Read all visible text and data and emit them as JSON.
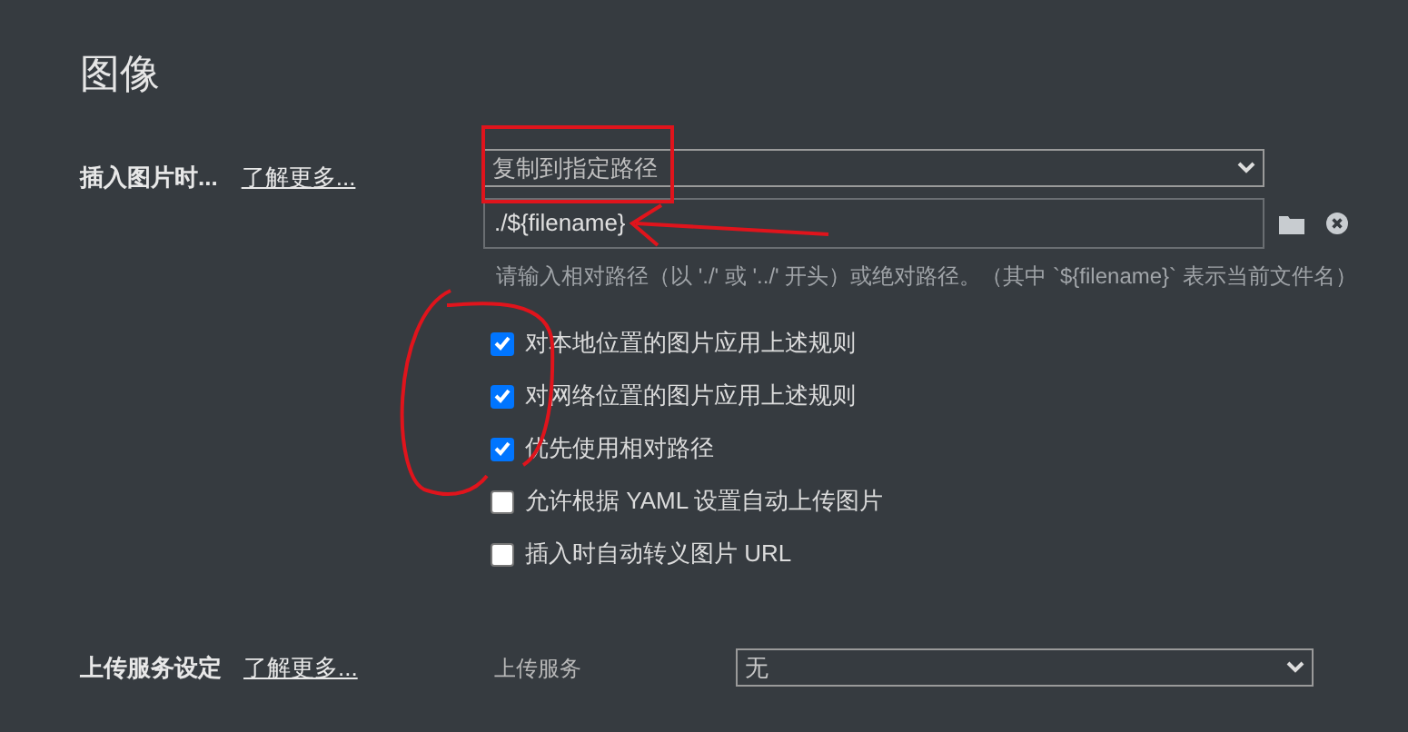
{
  "section_title": "图像",
  "insert_image": {
    "label": "插入图片时...",
    "learn_more": "了解更多...",
    "action": "复制到指定路径",
    "path": "./${filename}",
    "hint": "请输入相对路径（以 './' 或 '../' 开头）或绝对路径。（其中 `${filename}` 表示当前文件名）"
  },
  "options": [
    {
      "label": "对本地位置的图片应用上述规则",
      "checked": true
    },
    {
      "label": "对网络位置的图片应用上述规则",
      "checked": true
    },
    {
      "label": "优先使用相对路径",
      "checked": true
    },
    {
      "label": "允许根据 YAML 设置自动上传图片",
      "checked": false
    },
    {
      "label": "插入时自动转义图片 URL",
      "checked": false
    }
  ],
  "upload": {
    "label": "上传服务设定",
    "learn_more": "了解更多...",
    "service_label": "上传服务",
    "service": "无"
  }
}
